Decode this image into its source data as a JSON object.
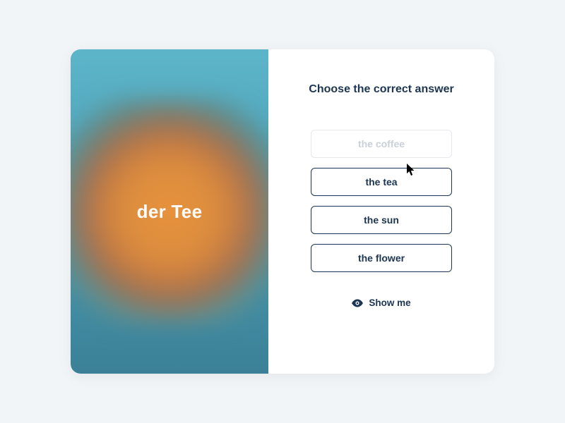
{
  "prompt": {
    "word": "der Tee"
  },
  "instruction": "Choose the correct answer",
  "options": [
    {
      "label": "the coffee",
      "faded": true
    },
    {
      "label": "the tea",
      "faded": false
    },
    {
      "label": "the sun",
      "faded": false
    },
    {
      "label": "the flower",
      "faded": false
    }
  ],
  "show_me_label": "Show me",
  "colors": {
    "text_primary": "#1c3553",
    "bg": "#f1f5f7"
  }
}
